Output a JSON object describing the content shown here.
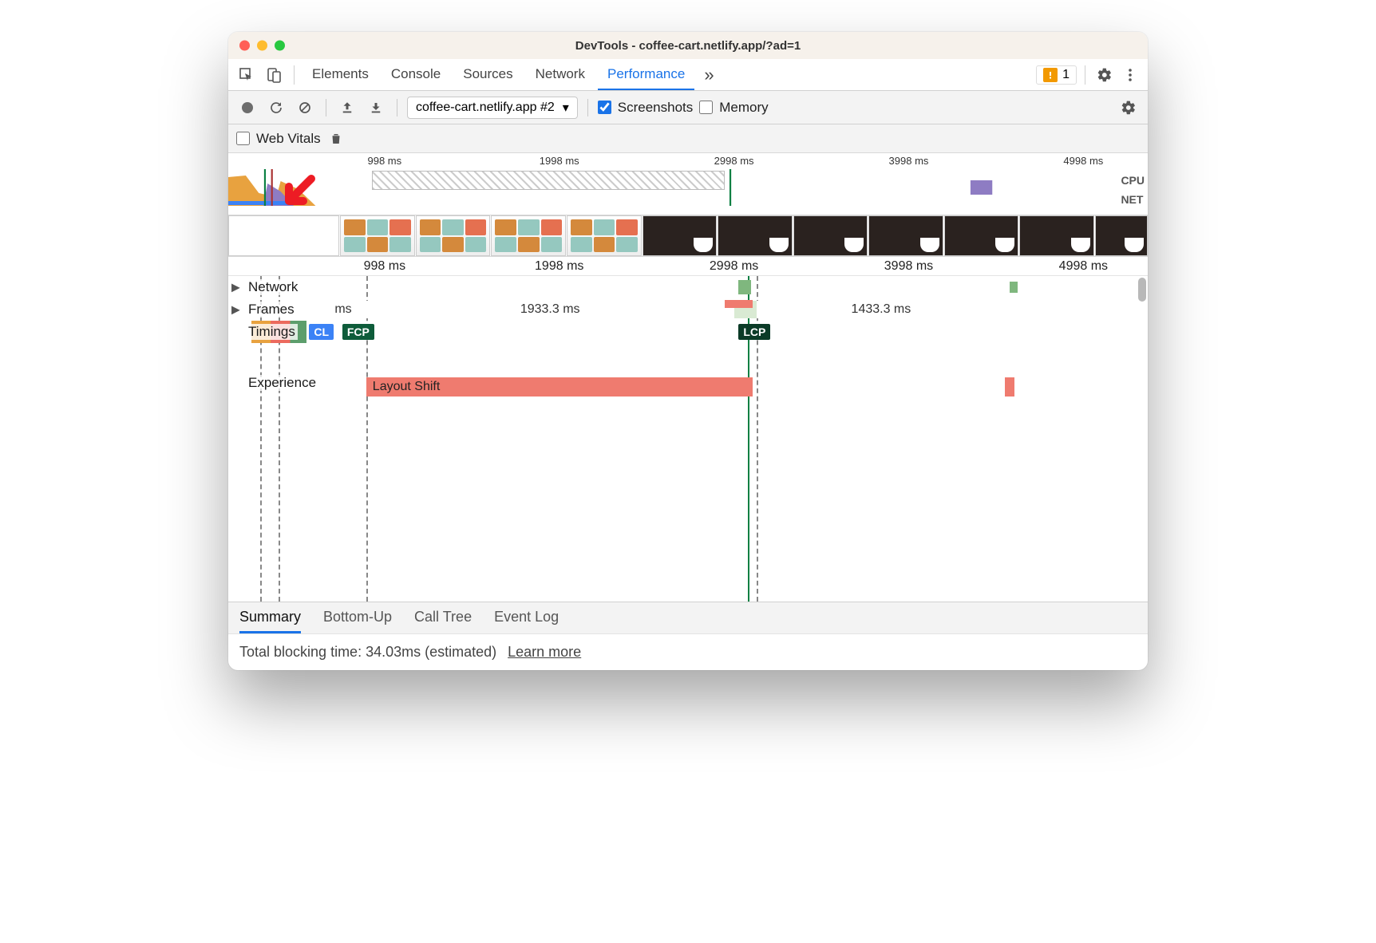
{
  "window": {
    "title": "DevTools - coffee-cart.netlify.app/?ad=1"
  },
  "panel_tabs": {
    "items": [
      "Elements",
      "Console",
      "Sources",
      "Network",
      "Performance"
    ],
    "active_index": 4,
    "issues_count": "1"
  },
  "perf_toolbar": {
    "recording_name": "coffee-cart.netlify.app #2",
    "screenshots_label": "Screenshots",
    "screenshots_checked": true,
    "memory_label": "Memory",
    "memory_checked": false,
    "web_vitals_label": "Web Vitals",
    "web_vitals_checked": false
  },
  "overview": {
    "ticks": [
      "998 ms",
      "1998 ms",
      "2998 ms",
      "3998 ms",
      "4998 ms"
    ],
    "cpu_label": "CPU",
    "net_label": "NET"
  },
  "main_ruler": {
    "ticks": [
      "998 ms",
      "1998 ms",
      "2998 ms",
      "3998 ms",
      "4998 ms"
    ]
  },
  "tracks": {
    "network_label": "Network",
    "frames_label": "Frames",
    "frames_segments": [
      "ms",
      "1933.3 ms",
      "",
      "1433.3 ms"
    ],
    "timings_label": "Timings",
    "timings_badges": {
      "cl": "CL",
      "fcp": "FCP",
      "lcp": "LCP"
    },
    "experience_label": "Experience",
    "layout_shift_label": "Layout Shift"
  },
  "detail_tabs": {
    "items": [
      "Summary",
      "Bottom-Up",
      "Call Tree",
      "Event Log"
    ],
    "active_index": 0
  },
  "summary": {
    "tbt_label": "Total blocking time: 34.03ms (estimated)",
    "learn_more": "Learn more"
  }
}
